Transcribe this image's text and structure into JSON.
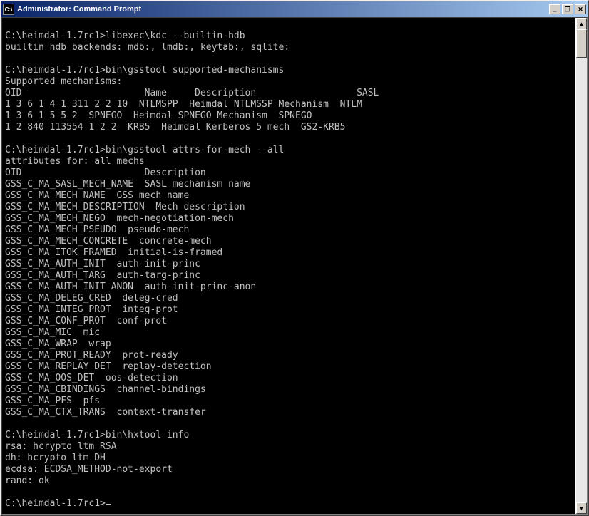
{
  "window": {
    "title": "Administrator: Command Prompt",
    "icon_label": "C:\\"
  },
  "titlebar_buttons": {
    "minimize": "_",
    "maximize": "❐",
    "close": "✕"
  },
  "scrollbar": {
    "up": "▲",
    "down": "▼"
  },
  "console": {
    "prompt": "C:\\heimdal-1.7rc1>",
    "lines": [
      "",
      "C:\\heimdal-1.7rc1>libexec\\kdc --builtin-hdb",
      "builtin hdb backends: mdb:, lmdb:, keytab:, sqlite:",
      "",
      "C:\\heimdal-1.7rc1>bin\\gsstool supported-mechanisms",
      "Supported mechanisms:",
      "OID                      Name     Description                  SASL",
      "1 3 6 1 4 1 311 2 2 10  NTLMSPP  Heimdal NTLMSSP Mechanism  NTLM",
      "1 3 6 1 5 5 2  SPNEGO  Heimdal SPNEGO Mechanism  SPNEGO",
      "1 2 840 113554 1 2 2  KRB5  Heimdal Kerberos 5 mech  GS2-KRB5",
      "",
      "C:\\heimdal-1.7rc1>bin\\gsstool attrs-for-mech --all",
      "attributes for: all mechs",
      "OID                      Description",
      "GSS_C_MA_SASL_MECH_NAME  SASL mechanism name",
      "GSS_C_MA_MECH_NAME  GSS mech name",
      "GSS_C_MA_MECH_DESCRIPTION  Mech description",
      "GSS_C_MA_MECH_NEGO  mech-negotiation-mech",
      "GSS_C_MA_MECH_PSEUDO  pseudo-mech",
      "GSS_C_MA_MECH_CONCRETE  concrete-mech",
      "GSS_C_MA_ITOK_FRAMED  initial-is-framed",
      "GSS_C_MA_AUTH_INIT  auth-init-princ",
      "GSS_C_MA_AUTH_TARG  auth-targ-princ",
      "GSS_C_MA_AUTH_INIT_ANON  auth-init-princ-anon",
      "GSS_C_MA_DELEG_CRED  deleg-cred",
      "GSS_C_MA_INTEG_PROT  integ-prot",
      "GSS_C_MA_CONF_PROT  conf-prot",
      "GSS_C_MA_MIC  mic",
      "GSS_C_MA_WRAP  wrap",
      "GSS_C_MA_PROT_READY  prot-ready",
      "GSS_C_MA_REPLAY_DET  replay-detection",
      "GSS_C_MA_OOS_DET  oos-detection",
      "GSS_C_MA_CBINDINGS  channel-bindings",
      "GSS_C_MA_PFS  pfs",
      "GSS_C_MA_CTX_TRANS  context-transfer",
      "",
      "C:\\heimdal-1.7rc1>bin\\hxtool info",
      "rsa: hcrypto ltm RSA",
      "dh: hcrypto ltm DH",
      "ecdsa: ECDSA_METHOD-not-export",
      "rand: ok",
      "",
      "C:\\heimdal-1.7rc1>"
    ]
  }
}
